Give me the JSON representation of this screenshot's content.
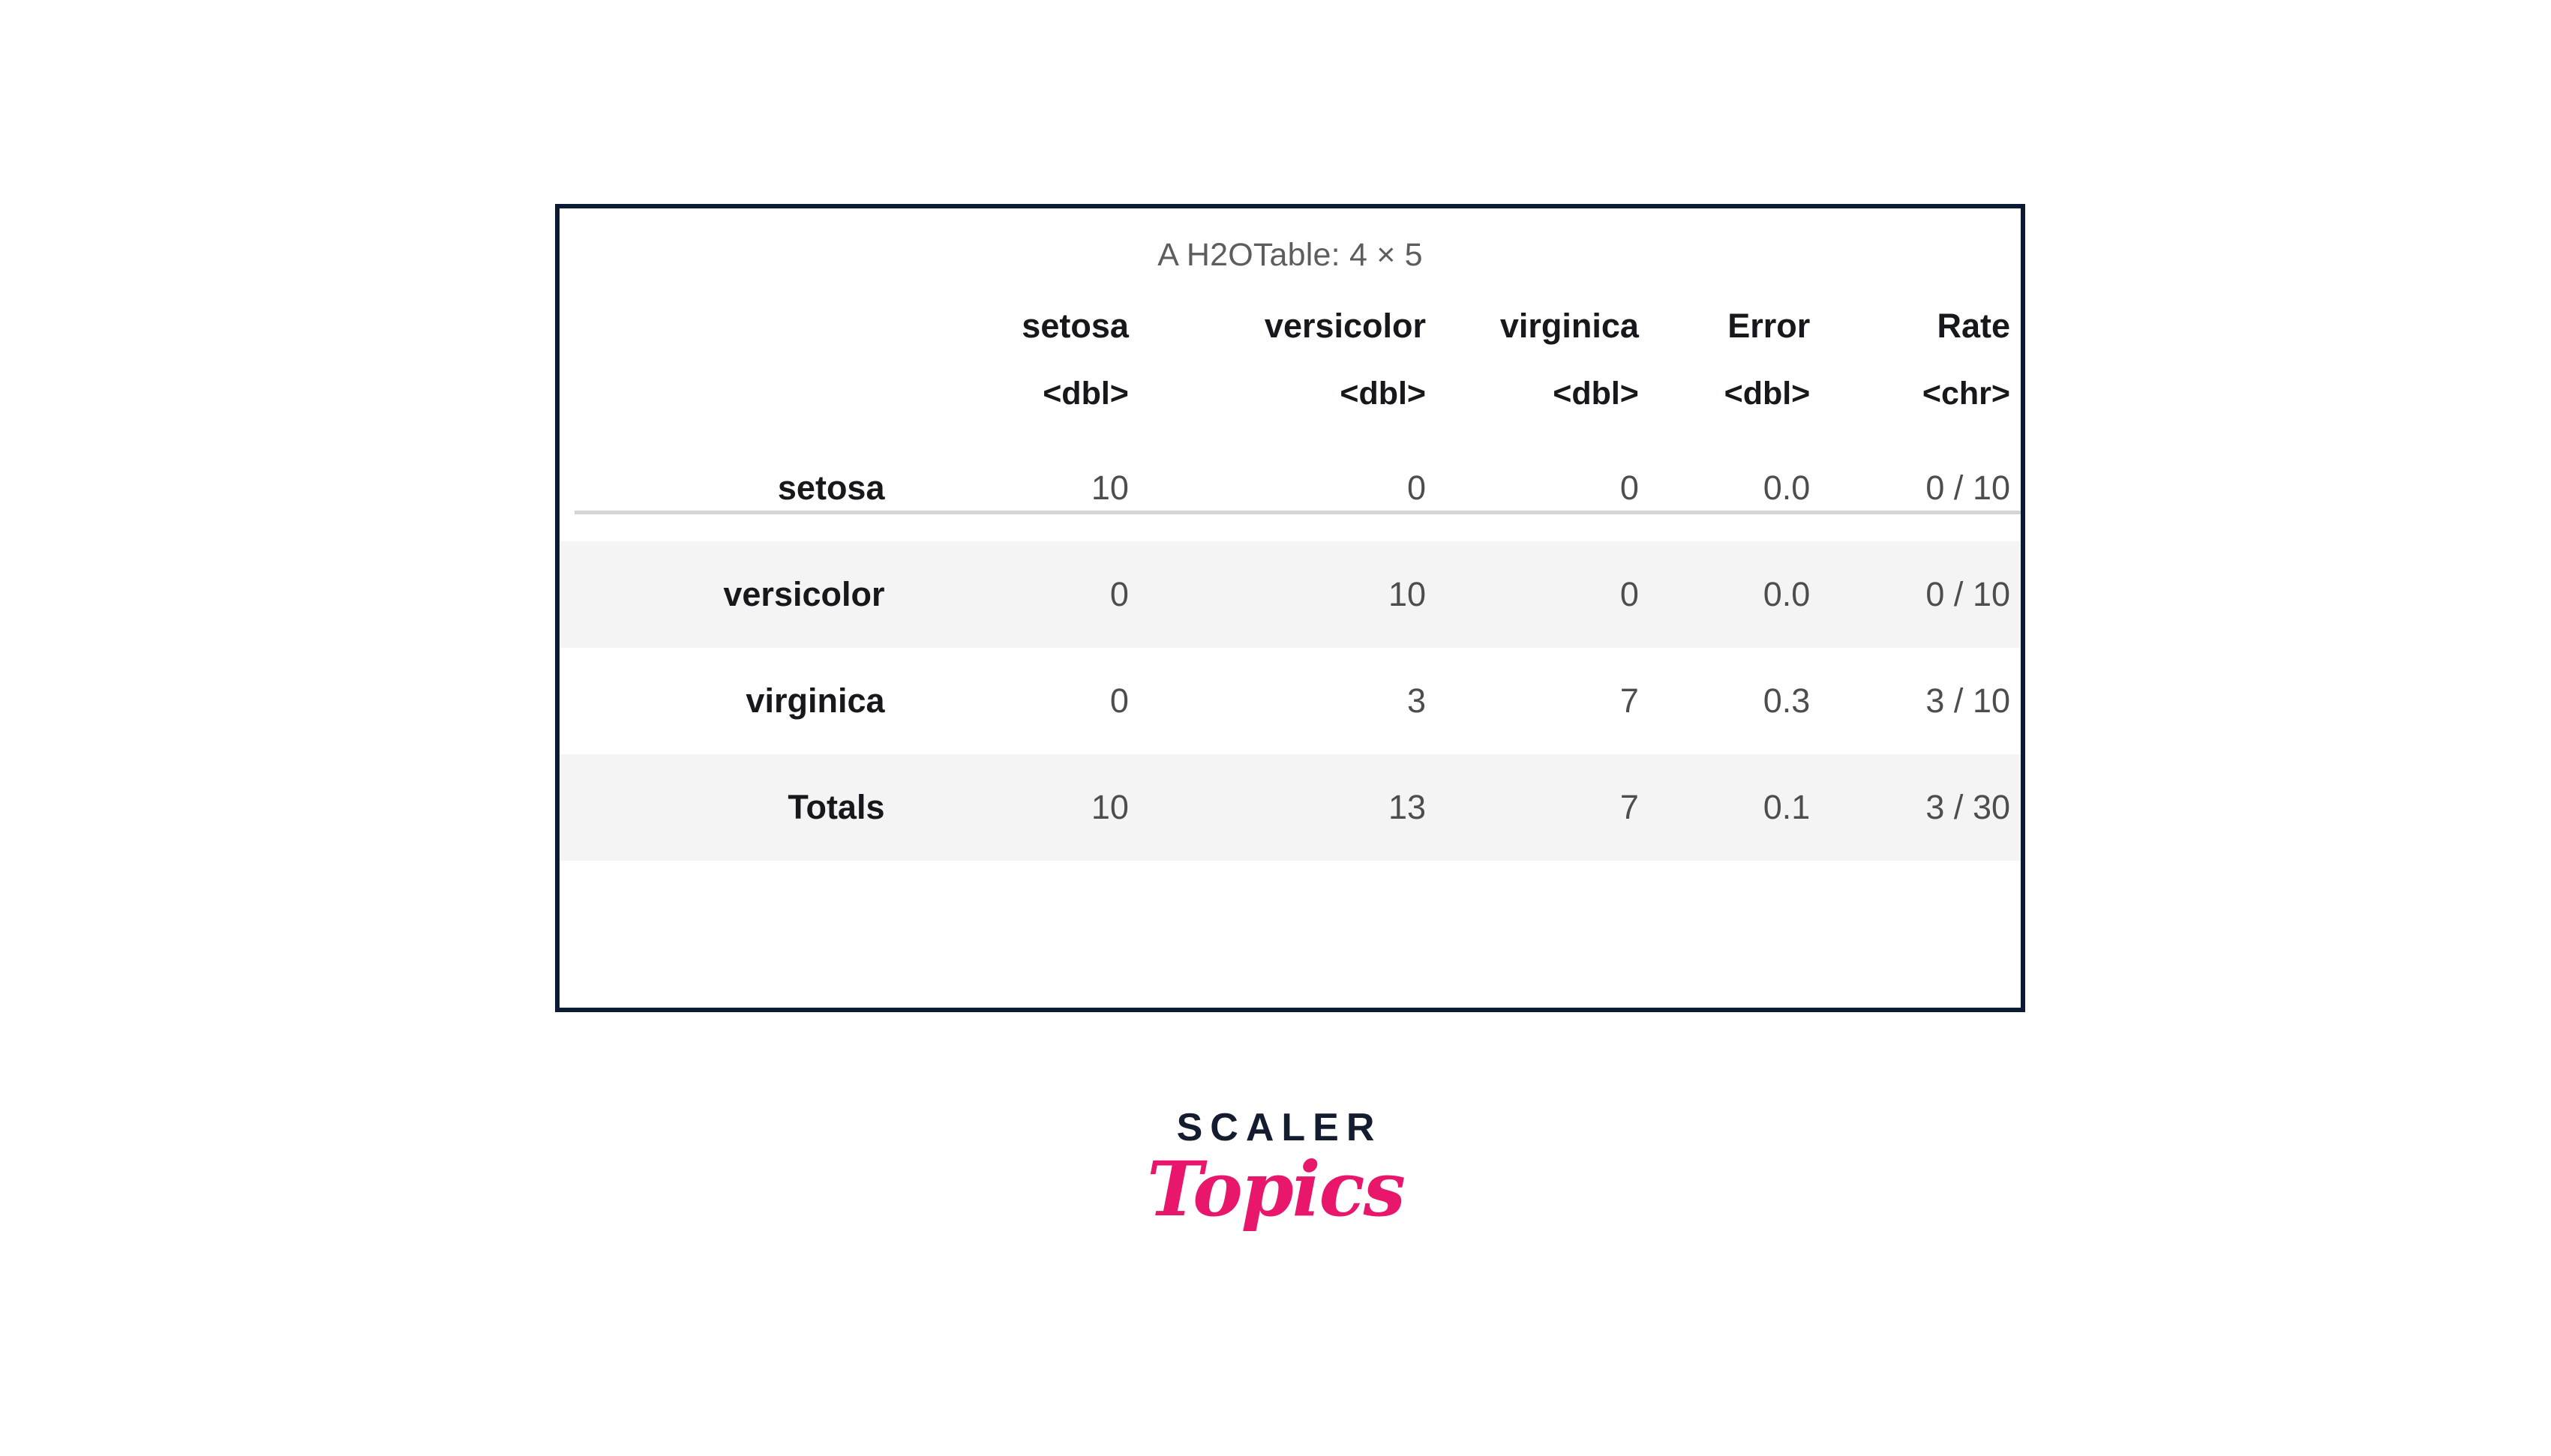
{
  "table": {
    "caption": "A H2OTable: 4 × 5",
    "columns": [
      "setosa",
      "versicolor",
      "virginica",
      "Error",
      "Rate"
    ],
    "column_types": [
      "<dbl>",
      "<dbl>",
      "<dbl>",
      "<dbl>",
      "<chr>"
    ],
    "row_label_header": "",
    "rows": [
      {
        "label": "setosa",
        "values": [
          "10",
          "0",
          "0",
          "0.0",
          "0 / 10"
        ]
      },
      {
        "label": "versicolor",
        "values": [
          "0",
          "10",
          "0",
          "0.0",
          "0 / 10"
        ]
      },
      {
        "label": "virginica",
        "values": [
          "0",
          "3",
          "7",
          "0.3",
          "3 / 10"
        ]
      },
      {
        "label": "Totals",
        "values": [
          "10",
          "13",
          "7",
          "0.1",
          "3 / 30"
        ]
      }
    ]
  },
  "logo": {
    "primary": "SCALER",
    "secondary": "Topics"
  },
  "colors": {
    "border": "#0c1a33",
    "stripe": "#f4f4f4",
    "caption_text": "#5d5d5d",
    "header_text": "#16181c",
    "cell_text": "#4d4d4d",
    "rule": "#d5d5d5",
    "logo_primary": "#141c2f",
    "logo_secondary": "#e8176b"
  },
  "chart_data": {
    "type": "table",
    "title": "A H2OTable: 4 × 5",
    "categories": [
      "setosa",
      "versicolor",
      "virginica",
      "Totals"
    ],
    "columns": [
      "setosa",
      "versicolor",
      "virginica",
      "Error",
      "Rate"
    ],
    "column_types": [
      "<dbl>",
      "<dbl>",
      "<dbl>",
      "<dbl>",
      "<chr>"
    ],
    "series": [
      {
        "name": "setosa",
        "values": [
          10,
          0,
          0,
          0.0,
          "0 / 10"
        ]
      },
      {
        "name": "versicolor",
        "values": [
          0,
          10,
          0,
          0.0,
          "0 / 10"
        ]
      },
      {
        "name": "virginica",
        "values": [
          0,
          3,
          7,
          0.3,
          "3 / 10"
        ]
      },
      {
        "name": "Totals",
        "values": [
          10,
          13,
          7,
          0.1,
          "3 / 30"
        ]
      }
    ]
  }
}
